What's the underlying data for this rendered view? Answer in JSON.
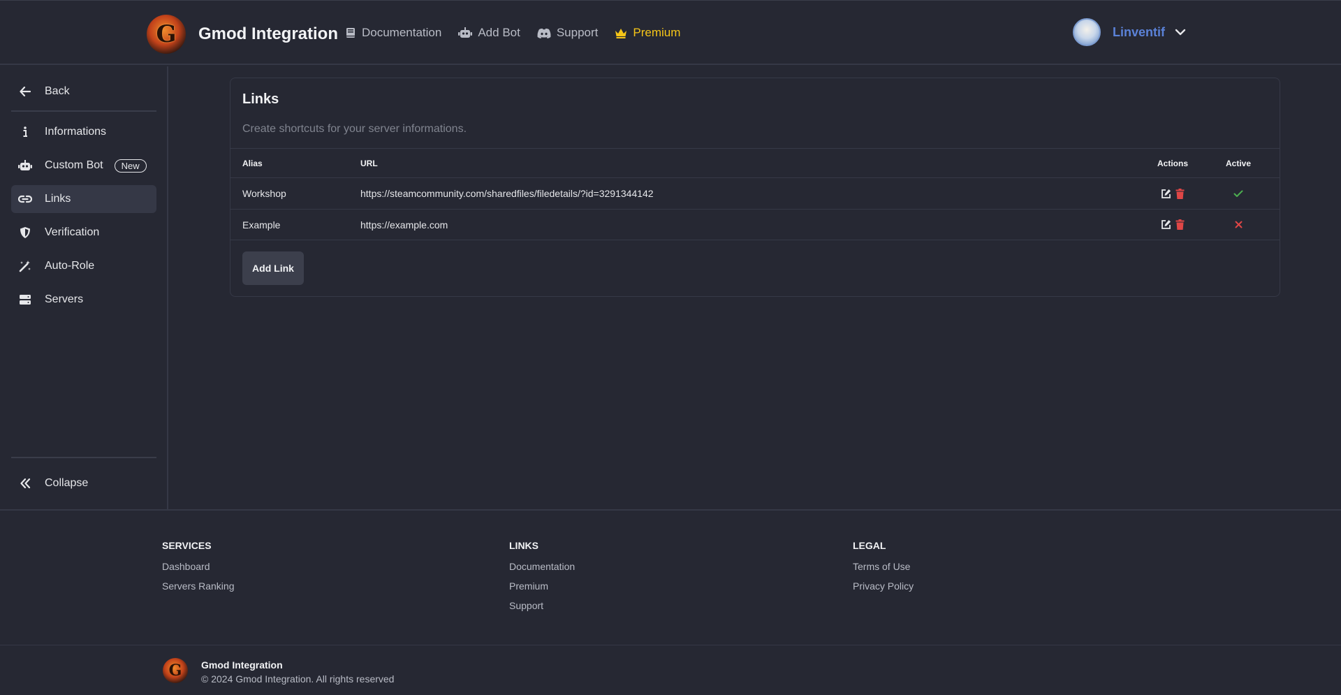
{
  "header": {
    "brand_name": "Gmod Integration",
    "logo_letter": "G",
    "nav": [
      {
        "label": "Documentation",
        "icon": "book-icon"
      },
      {
        "label": "Add Bot",
        "icon": "robot-icon"
      },
      {
        "label": "Support",
        "icon": "discord-icon"
      },
      {
        "label": "Premium",
        "icon": "crown-icon"
      }
    ],
    "user_name": "Linventif"
  },
  "sidebar": {
    "back": "Back",
    "items": [
      {
        "label": "Informations",
        "icon": "info-icon"
      },
      {
        "label": "Custom Bot",
        "icon": "robot-icon",
        "badge": "New"
      },
      {
        "label": "Links",
        "icon": "link-icon"
      },
      {
        "label": "Verification",
        "icon": "shield-icon"
      },
      {
        "label": "Auto-Role",
        "icon": "wand-icon"
      },
      {
        "label": "Servers",
        "icon": "server-icon"
      }
    ],
    "collapse": "Collapse"
  },
  "links_card": {
    "title": "Links",
    "description": "Create shortcuts for your server informations.",
    "columns": [
      "Alias",
      "URL",
      "Active",
      "Actions"
    ],
    "rows": [
      {
        "alias": "Workshop",
        "url": "https://steamcommunity.com/sharedfiles/filedetails/?id=3291344142",
        "active": true
      },
      {
        "alias": "Example",
        "url": "https://example.com",
        "active": false
      }
    ],
    "add_button": "Add Link"
  },
  "footer": {
    "services": {
      "title": "SERVICES",
      "links": [
        "Dashboard",
        "Servers Ranking"
      ]
    },
    "links": {
      "title": "LINKS",
      "links": [
        "Documentation",
        "Premium",
        "Support"
      ]
    },
    "legal": {
      "title": "LEGAL",
      "links": [
        "Terms of Use",
        "Privacy Policy"
      ]
    },
    "brand_name": "Gmod Integration",
    "copyright": "© 2024 Gmod Integration. All rights reserved"
  },
  "colors": {
    "background": "#262833",
    "accent_user": "#5b82d8",
    "premium": "#f5c518",
    "active_check": "#4caf50",
    "inactive_x": "#e04646",
    "delete": "#e04646"
  }
}
